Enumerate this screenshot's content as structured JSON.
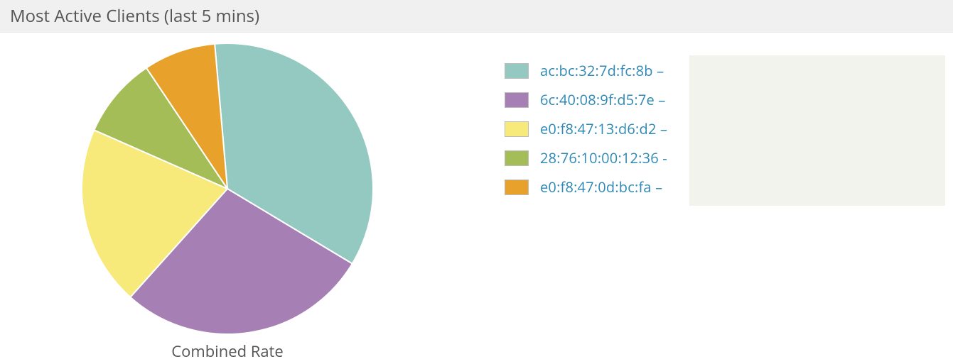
{
  "header": {
    "title": "Most Active Clients (last 5 mins)"
  },
  "chart": {
    "caption": "Combined Rate"
  },
  "legend": {
    "items": [
      {
        "label": "ac:bc:32:7d:fc:8b –",
        "color": "#93c9c1"
      },
      {
        "label": "6c:40:08:9f:d5:7e –",
        "color": "#a67fb4"
      },
      {
        "label": "e0:f8:47:13:d6:d2 –",
        "color": "#f7e97a"
      },
      {
        "label": "28:76:10:00:12:36 -",
        "color": "#a5bd56"
      },
      {
        "label": "e0:f8:47:0d:bc:fa –",
        "color": "#e8a22c"
      }
    ]
  },
  "chart_data": {
    "type": "pie",
    "title": "Most Active Clients (last 5 mins)",
    "subtitle": "Combined Rate",
    "series": [
      {
        "name": "ac:bc:32:7d:fc:8b",
        "value": 35,
        "color": "#93c9c1"
      },
      {
        "name": "6c:40:08:9f:d5:7e",
        "value": 28,
        "color": "#a67fb4"
      },
      {
        "name": "e0:f8:47:13:d6:d2",
        "value": 20,
        "color": "#f7e97a"
      },
      {
        "name": "28:76:10:00:12:36",
        "value": 9,
        "color": "#a5bd56"
      },
      {
        "name": "e0:f8:47:0d:bc:fa",
        "value": 8,
        "color": "#e8a22c"
      }
    ]
  }
}
